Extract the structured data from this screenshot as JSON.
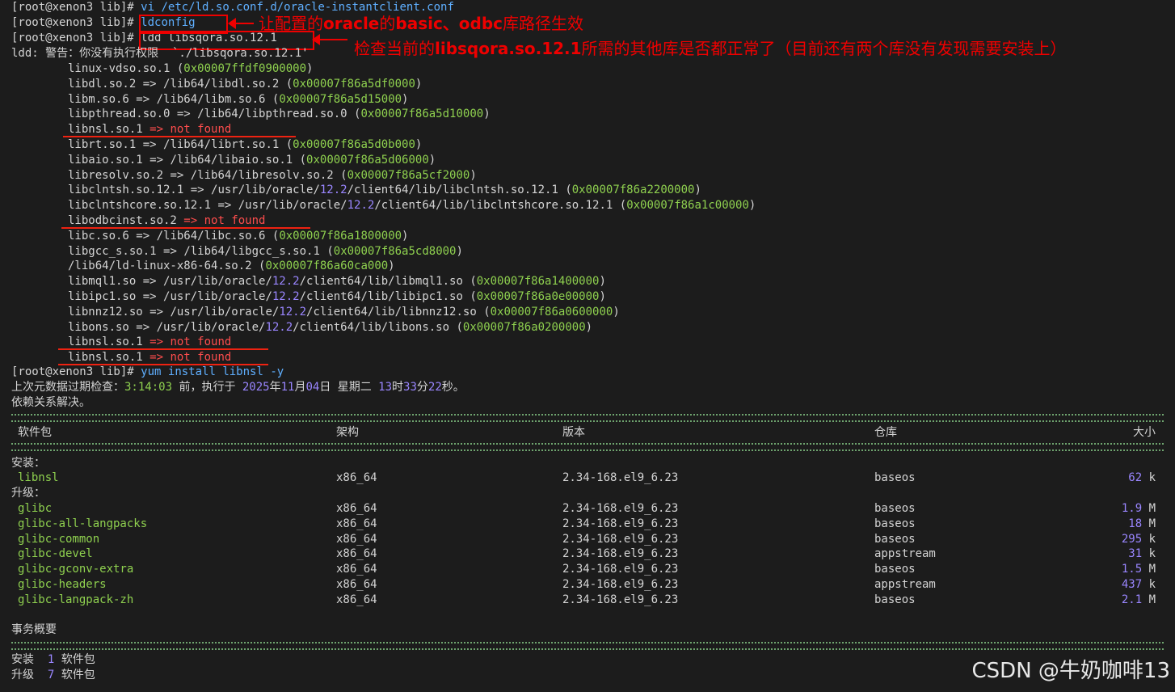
{
  "prompt": "[root@xenon3 lib]",
  "prompt_hash": "#",
  "commands": [
    "vi /etc/ld.so.conf.d/oracle-instantclient.conf",
    "ldconfig",
    "ldd libsqora.so.12.1"
  ],
  "annotations": {
    "ldconfig_a": "让配置的",
    "ldconfig_b": "oracle",
    "ldconfig_c": "的",
    "ldconfig_d": "basic、odbc",
    "ldconfig_e": "库路径生效",
    "ldd_a": "检查当前的",
    "ldd_b": "libsqora.so.12.1",
    "ldd_c": "所需的其他库是否都正常了（目前还有两个库没有发现需要安装上）"
  },
  "ldd_warning": "ldd: 警告：你没有执行权限  `./libsqora.so.12.1'",
  "ldd_lines": [
    {
      "name": "linux-vdso.so.1",
      "path": "",
      "addr": "0x00007ffdf0900000",
      "found": true
    },
    {
      "name": "libdl.so.2",
      "path": "/lib64/libdl.so.2",
      "addr": "0x00007f86a5df0000",
      "found": true
    },
    {
      "name": "libm.so.6",
      "path": "/lib64/libm.so.6",
      "addr": "0x00007f86a5d15000",
      "found": true
    },
    {
      "name": "libpthread.so.0",
      "path": "/lib64/libpthread.so.0",
      "addr": "0x00007f86a5d10000",
      "found": true
    },
    {
      "name": "libnsl.so.1",
      "path": "",
      "addr": "",
      "found": false
    },
    {
      "name": "librt.so.1",
      "path": "/lib64/librt.so.1",
      "addr": "0x00007f86a5d0b000",
      "found": true
    },
    {
      "name": "libaio.so.1",
      "path": "/lib64/libaio.so.1",
      "addr": "0x00007f86a5d06000",
      "found": true
    },
    {
      "name": "libresolv.so.2",
      "path": "/lib64/libresolv.so.2",
      "addr": "0x00007f86a5cf2000",
      "found": true
    },
    {
      "name": "libclntsh.so.12.1",
      "path": "/usr/lib/oracle/12.2/client64/lib/libclntsh.so.12.1",
      "addr": "0x00007f86a2200000",
      "found": true
    },
    {
      "name": "libclntshcore.so.12.1",
      "path": "/usr/lib/oracle/12.2/client64/lib/libclntshcore.so.12.1",
      "addr": "0x00007f86a1c00000",
      "found": true
    },
    {
      "name": "libodbcinst.so.2",
      "path": "",
      "addr": "",
      "found": false
    },
    {
      "name": "libc.so.6",
      "path": "/lib64/libc.so.6",
      "addr": "0x00007f86a1800000",
      "found": true
    },
    {
      "name": "libgcc_s.so.1",
      "path": "/lib64/libgcc_s.so.1",
      "addr": "0x00007f86a5cd8000",
      "found": true
    },
    {
      "name": "/lib64/ld-linux-x86-64.so.2",
      "path": "",
      "addr": "0x00007f86a60ca000",
      "found": true
    },
    {
      "name": "libmql1.so",
      "path": "/usr/lib/oracle/12.2/client64/lib/libmql1.so",
      "addr": "0x00007f86a1400000",
      "found": true
    },
    {
      "name": "libipc1.so",
      "path": "/usr/lib/oracle/12.2/client64/lib/libipc1.so",
      "addr": "0x00007f86a0e00000",
      "found": true
    },
    {
      "name": "libnnz12.so",
      "path": "/usr/lib/oracle/12.2/client64/lib/libnnz12.so",
      "addr": "0x00007f86a0600000",
      "found": true
    },
    {
      "name": "libons.so",
      "path": "/usr/lib/oracle/12.2/client64/lib/libons.so",
      "addr": "0x00007f86a0200000",
      "found": true
    },
    {
      "name": "libnsl.so.1",
      "path": "",
      "addr": "",
      "found": false
    },
    {
      "name": "libnsl.so.1",
      "path": "",
      "addr": "",
      "found": false
    }
  ],
  "arrow": "=>",
  "not_found": "not found",
  "yum_cmd": "yum install libnsl -y",
  "metadata_line": {
    "prefix": "上次元数据过期检查：",
    "elapsed": "3:14:03",
    "mid": " 前，执行于 ",
    "year": "2025",
    "year_u": "年",
    "month": "11",
    "month_u": "月",
    "day": "04",
    "day_u": "日 星期二 ",
    "hour": "13",
    "hour_u": "时",
    "minute": "33",
    "minute_u": "分",
    "second": "22",
    "second_u": "秒。"
  },
  "deps_resolved": "依赖关系解决。",
  "separator": "================================================================================================================================================================",
  "table_headers": {
    "package": "软件包",
    "arch": "架构",
    "version": "版本",
    "repo": "仓库",
    "size": "大小"
  },
  "install_label": "安装：",
  "upgrade_label": "升级：",
  "install_rows": [
    {
      "name": "libnsl",
      "arch": "x86_64",
      "version": "2.34-168.el9_6.23",
      "repo": "baseos",
      "size": "62",
      "unit": "k"
    }
  ],
  "upgrade_rows": [
    {
      "name": "glibc",
      "arch": "x86_64",
      "version": "2.34-168.el9_6.23",
      "repo": "baseos",
      "size": "1.9",
      "unit": "M"
    },
    {
      "name": "glibc-all-langpacks",
      "arch": "x86_64",
      "version": "2.34-168.el9_6.23",
      "repo": "baseos",
      "size": "18",
      "unit": "M"
    },
    {
      "name": "glibc-common",
      "arch": "x86_64",
      "version": "2.34-168.el9_6.23",
      "repo": "baseos",
      "size": "295",
      "unit": "k"
    },
    {
      "name": "glibc-devel",
      "arch": "x86_64",
      "version": "2.34-168.el9_6.23",
      "repo": "appstream",
      "size": "31",
      "unit": "k"
    },
    {
      "name": "glibc-gconv-extra",
      "arch": "x86_64",
      "version": "2.34-168.el9_6.23",
      "repo": "baseos",
      "size": "1.5",
      "unit": "M"
    },
    {
      "name": "glibc-headers",
      "arch": "x86_64",
      "version": "2.34-168.el9_6.23",
      "repo": "appstream",
      "size": "437",
      "unit": "k"
    },
    {
      "name": "glibc-langpack-zh",
      "arch": "x86_64",
      "version": "2.34-168.el9_6.23",
      "repo": "baseos",
      "size": "2.1",
      "unit": "M"
    }
  ],
  "summary_title": "事务概要",
  "summary": [
    {
      "label": "安装",
      "count": "1",
      "unit": "软件包"
    },
    {
      "label": "升级",
      "count": "7",
      "unit": "软件包"
    }
  ],
  "watermark": "CSDN @牛奶咖啡13",
  "colors": {
    "background": "#1c1c1c",
    "command": "#5fafff",
    "package": "#8fd14f",
    "error": "#ff4d4d",
    "annotation": "#e00000",
    "number": "#9a86ff"
  }
}
